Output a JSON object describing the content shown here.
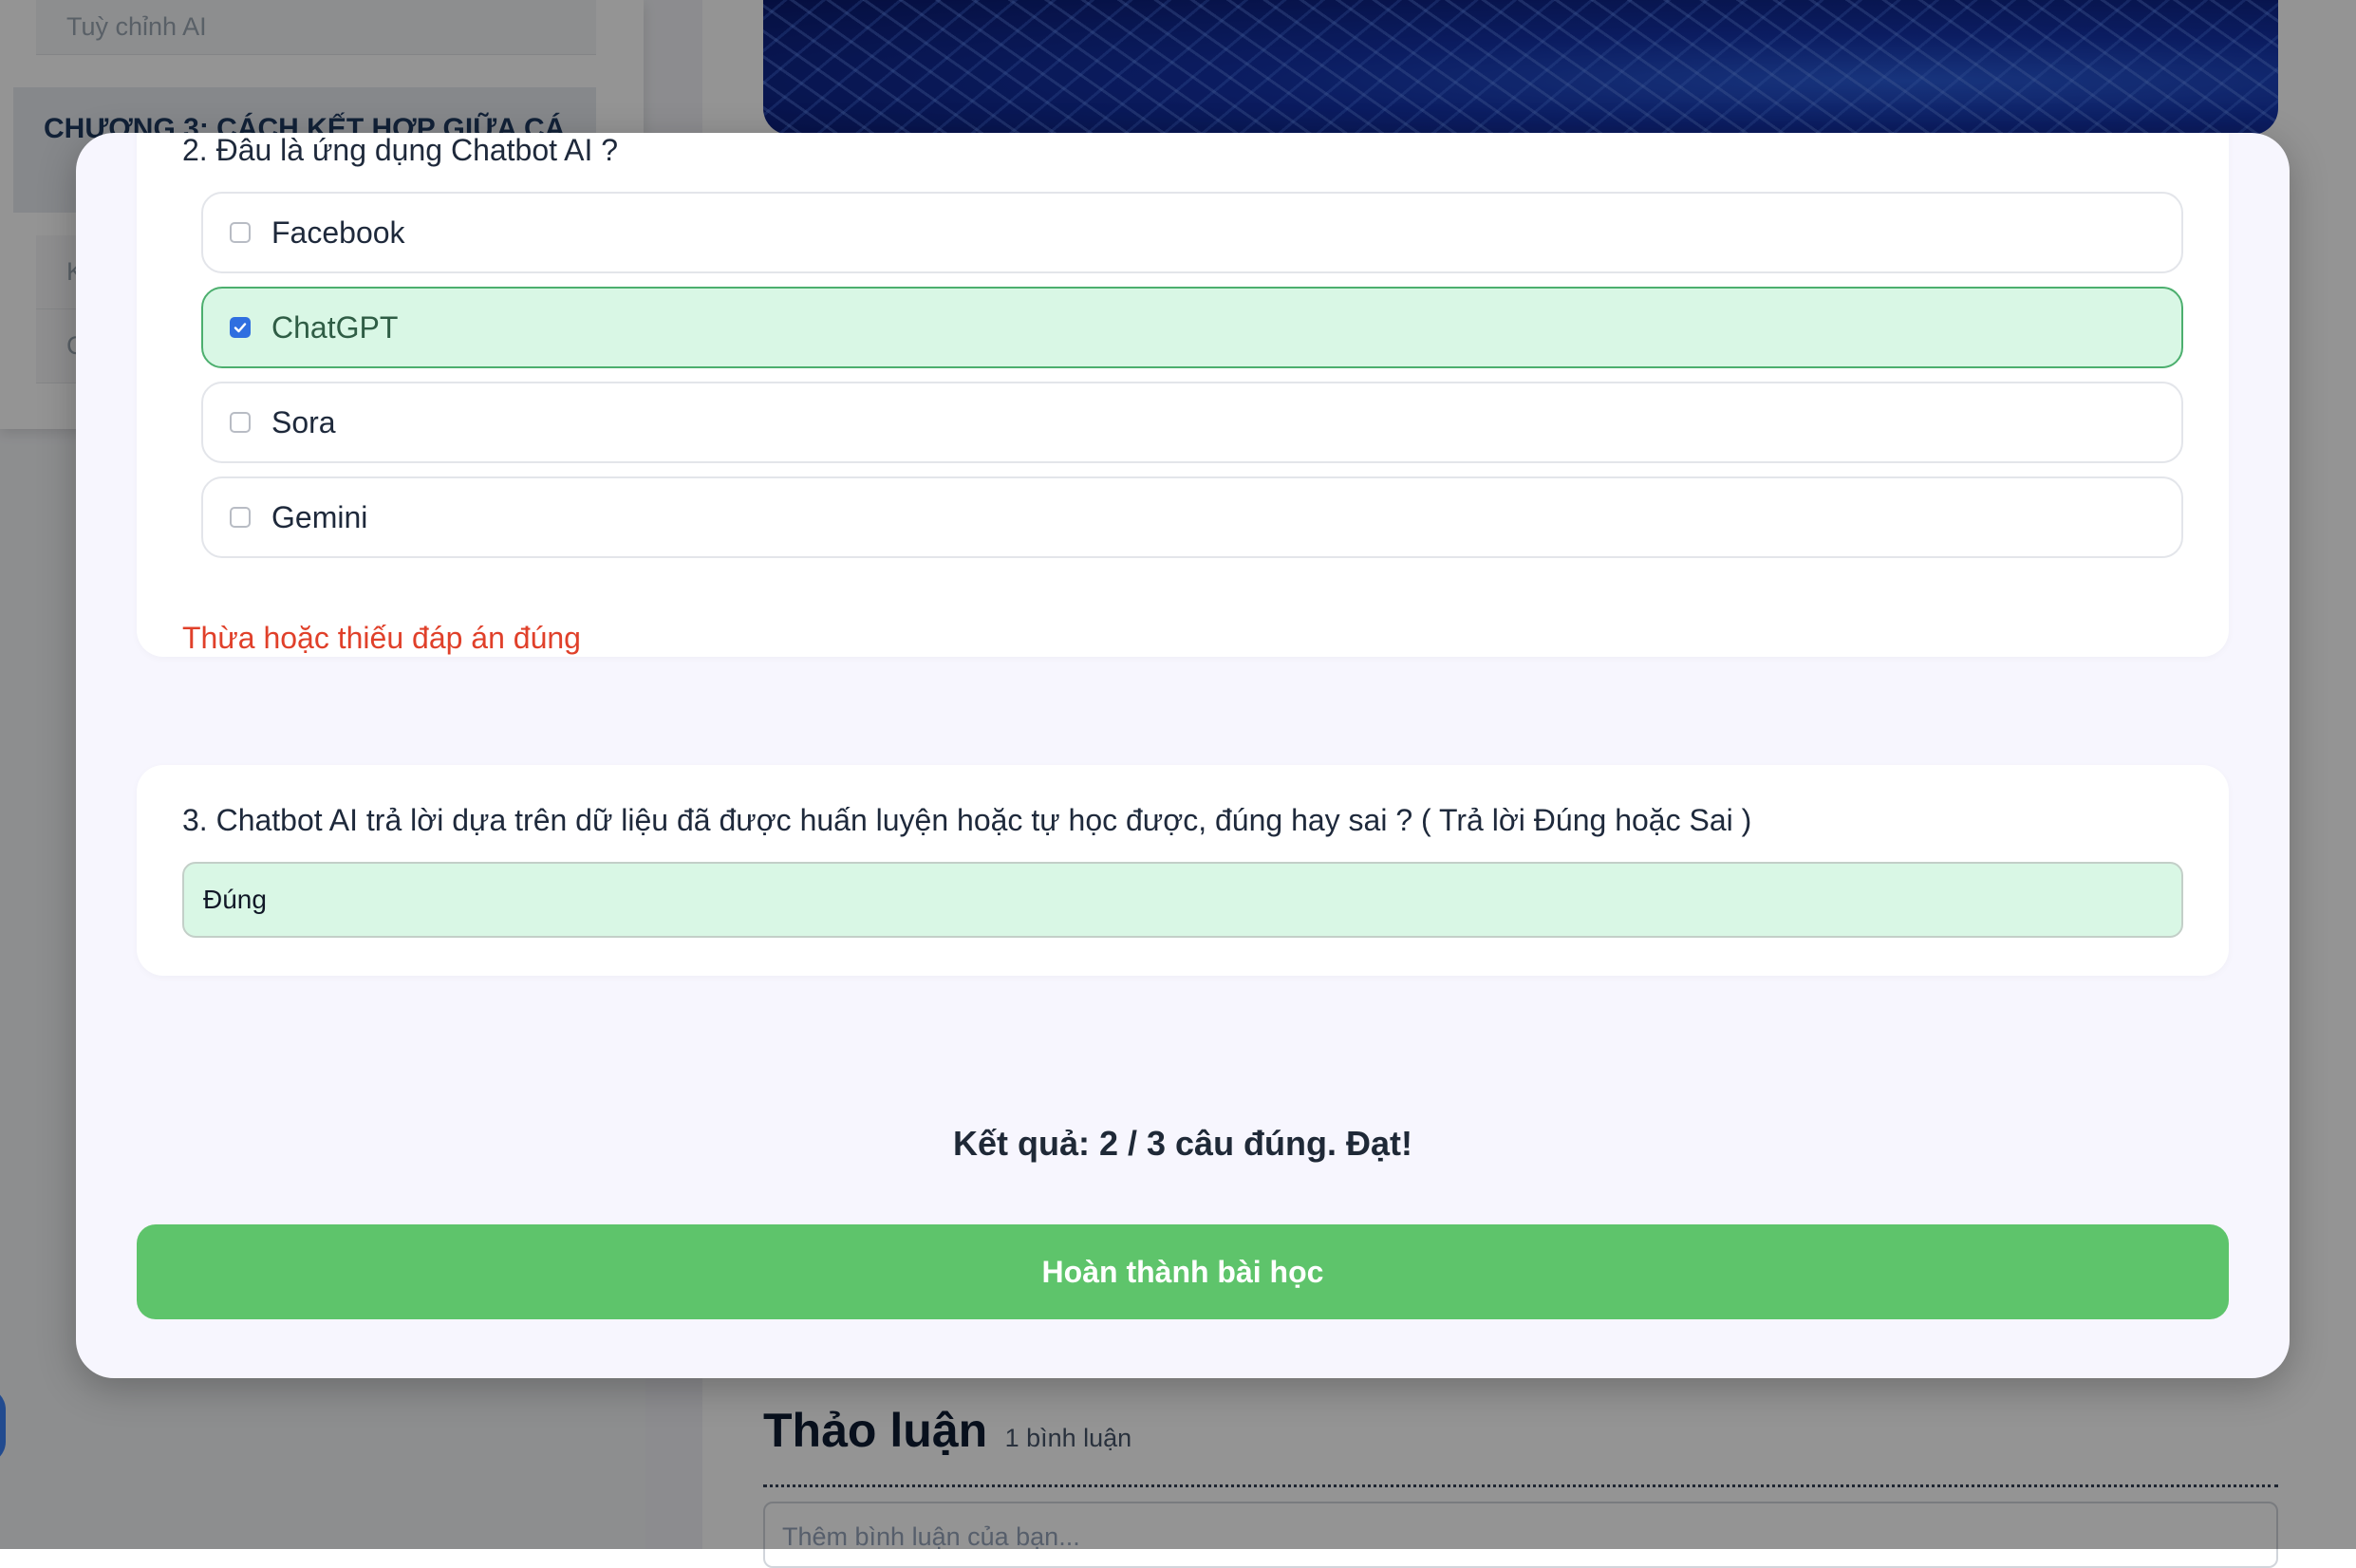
{
  "sidebar": {
    "top_lesson": "Tuỳ chỉnh AI",
    "chapter_title": "CHƯƠNG 3: CÁCH KẾT HỢP GIỮA CÁ",
    "lessons": [
      "K",
      "C"
    ]
  },
  "discussion": {
    "title": "Thảo luận",
    "count": "1 bình luận",
    "comment_placeholder": "Thêm bình luận của bạn..."
  },
  "quiz": {
    "question2": {
      "title": "2. Đâu là ứng dụng Chatbot AI ?",
      "options": [
        {
          "label": "Facebook",
          "checked": false
        },
        {
          "label": "ChatGPT",
          "checked": true
        },
        {
          "label": "Sora",
          "checked": false
        },
        {
          "label": "Gemini",
          "checked": false
        }
      ],
      "error": "Thừa hoặc thiếu đáp án đúng"
    },
    "question3": {
      "title": "3. Chatbot AI trả lời dựa trên dữ liệu đã được huấn luyện hoặc tự học được, đúng hay sai ? ( Trả lời Đúng hoặc Sai )",
      "answer": "Đúng"
    },
    "result": "Kết quả: 2 / 3 câu đúng. Đạt!",
    "finish_button": "Hoàn thành bài học"
  },
  "colors": {
    "correct_bg": "#d9f7e5",
    "error_text": "#e0402a",
    "finish_button": "#5ec46b",
    "checkbox_checked": "#2f6fe0"
  }
}
